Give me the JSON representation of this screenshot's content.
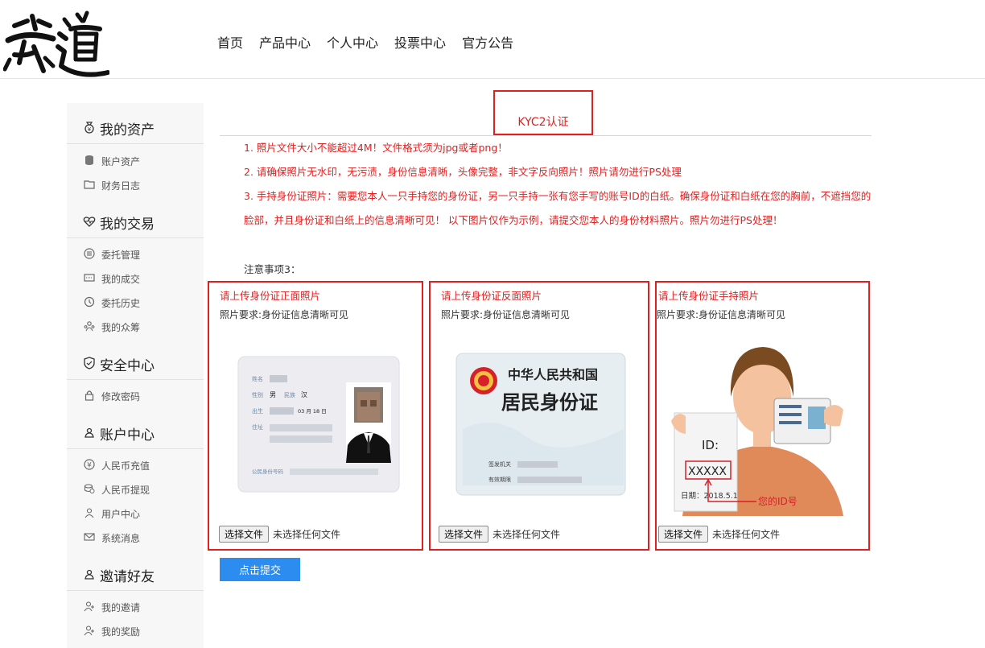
{
  "header": {
    "logo_text": "荣道",
    "nav": [
      "首页",
      "产品中心",
      "个人中心",
      "投票中心",
      "官方公告"
    ]
  },
  "sidebar": {
    "sections": [
      {
        "title": "我的资产",
        "icon": "money-bag-icon",
        "items": [
          {
            "label": "账户资产",
            "icon": "coins-icon"
          },
          {
            "label": "财务日志",
            "icon": "folder-icon"
          }
        ]
      },
      {
        "title": "我的交易",
        "icon": "heart-pulse-icon",
        "items": [
          {
            "label": "委托管理",
            "icon": "coin-stack-icon"
          },
          {
            "label": "我的成交",
            "icon": "ticket-icon"
          },
          {
            "label": "委托历史",
            "icon": "history-icon"
          },
          {
            "label": "我的众筹",
            "icon": "people-icon"
          }
        ]
      },
      {
        "title": "安全中心",
        "icon": "shield-icon",
        "items": [
          {
            "label": "修改密码",
            "icon": "lock-icon"
          }
        ]
      },
      {
        "title": "账户中心",
        "icon": "user-icon",
        "items": [
          {
            "label": "人民币充值",
            "icon": "yuan-icon"
          },
          {
            "label": "人民币提现",
            "icon": "coins-icon"
          },
          {
            "label": "用户中心",
            "icon": "user-icon"
          },
          {
            "label": "系统消息",
            "icon": "mail-icon"
          }
        ]
      },
      {
        "title": "邀请好友",
        "icon": "user-icon",
        "items": [
          {
            "label": "我的邀请",
            "icon": "user-add-icon"
          },
          {
            "label": "我的奖励",
            "icon": "user-add-icon"
          }
        ]
      }
    ]
  },
  "main": {
    "kyc_title": "KYC2认证",
    "notices": [
      "1. 照片文件大小不能超过4M！文件格式须为jpg或者png！",
      "2. 请确保照片无水印，无污渍，身份信息清晰，头像完整，非文字反向照片！照片请勿进行PS处理",
      "3. 手持身份证照片：需要您本人一只手持您的身份证，另一只手持一张有您手写的账号ID的白纸。确保身份证和白纸在您的胸前，不遮挡您的脸部，并且身份证和白纸上的信息清晰可见！ 以下图片仅作为示例，请提交您本人的身份材料照片。照片勿进行PS处理！"
    ],
    "note3": "注意事项3：",
    "uploads": [
      {
        "title": "请上传身份证正面照片",
        "requirement": "照片要求:身份证信息清晰可见",
        "button": "选择文件",
        "status": "未选择任何文件"
      },
      {
        "title": "请上传身份证反面照片",
        "requirement": "照片要求:身份证信息清晰可见",
        "button": "选择文件",
        "status": "未选择任何文件"
      },
      {
        "title": "请上传身份证手持照片",
        "requirement": "照片要求:身份证信息清晰可见",
        "button": "选择文件",
        "status": "未选择任何文件"
      }
    ],
    "front_card": {
      "name_label": "姓名",
      "sex_label": "性别",
      "sex_value": "男",
      "ethnic_label": "民族",
      "ethnic_value": "汉",
      "birth_label": "出生",
      "birth_value": "03 月 18 日",
      "address_label": "住址",
      "id_label": "公民身份号码"
    },
    "back_card": {
      "country": "中华人民共和国",
      "title": "居民身份证",
      "authority_label": "签发机关",
      "valid_label": "有效期限"
    },
    "holding": {
      "id_label": "ID:",
      "id_value": "XXXXX",
      "date_text": "日期：2018.5.1",
      "arrow_note": "您的ID号"
    },
    "submit_label": "点击提交"
  }
}
